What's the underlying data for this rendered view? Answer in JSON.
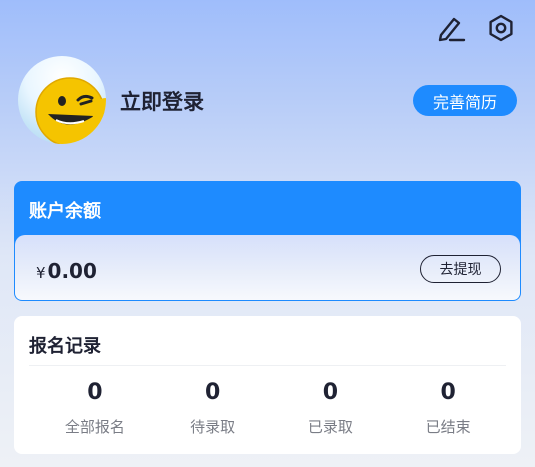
{
  "header": {
    "icons": [
      "edit-icon",
      "settings-icon"
    ]
  },
  "profile": {
    "login_label": "立即登录",
    "resume_button": "完善简历",
    "avatar": "winking-smiley-avatar"
  },
  "balance": {
    "title": "账户余额",
    "currency_symbol": "¥",
    "amount": "0.00",
    "withdraw_button": "去提现"
  },
  "records": {
    "title": "报名记录",
    "stats": [
      {
        "value": "0",
        "label": "全部报名"
      },
      {
        "value": "0",
        "label": "待录取"
      },
      {
        "value": "0",
        "label": "已录取"
      },
      {
        "value": "0",
        "label": "已结束"
      }
    ]
  },
  "colors": {
    "accent": "#1e8bff",
    "text": "#1f2233",
    "muted": "#7a7d86"
  }
}
